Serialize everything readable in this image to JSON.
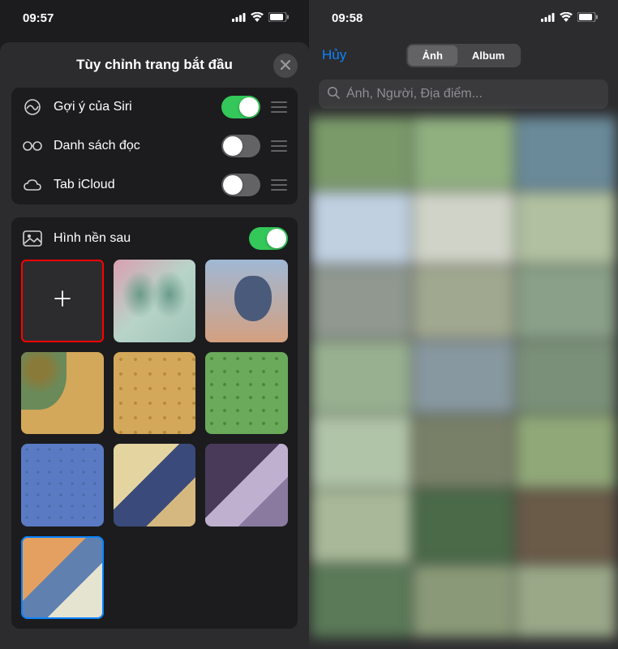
{
  "left": {
    "status_time": "09:57",
    "modal_title": "Tùy chỉnh trang bắt đầu",
    "settings": [
      {
        "label": "Gợi ý của Siri",
        "on": true
      },
      {
        "label": "Danh sách đọc",
        "on": false
      },
      {
        "label": "Tab iCloud",
        "on": false
      }
    ],
    "wallpaper_label": "Hình nền sau"
  },
  "right": {
    "status_time": "09:58",
    "cancel": "Hủy",
    "segments": {
      "photos": "Ảnh",
      "albums": "Album"
    },
    "search_placeholder": "Ảnh, Người, Địa điểm..."
  }
}
